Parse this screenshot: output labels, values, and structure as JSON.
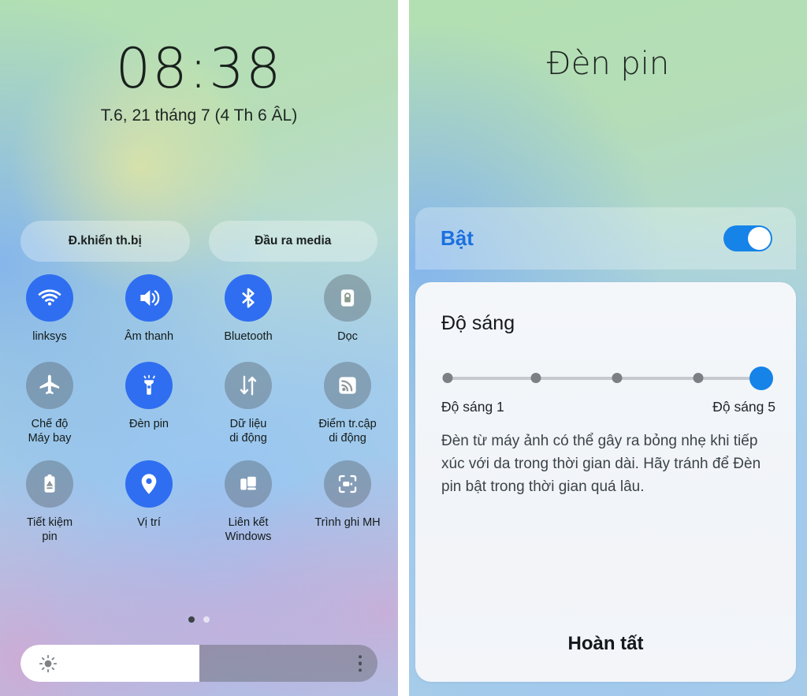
{
  "lockscreen": {
    "time": "08:38",
    "date": "T.6, 21 tháng 7 (4 Th 6 ÂL)"
  },
  "quick_panel": {
    "pills": [
      {
        "label": "Đ.khiển th.bị",
        "icon": "device-control-icon"
      },
      {
        "label": "Đầu ra media",
        "icon": "media-output-icon"
      }
    ],
    "tiles": [
      {
        "label": "linksys",
        "icon": "wifi-icon",
        "state": "on"
      },
      {
        "label": "Âm thanh",
        "icon": "sound-icon",
        "state": "on"
      },
      {
        "label": "Bluetooth",
        "icon": "bluetooth-icon",
        "state": "on"
      },
      {
        "label": "Dọc",
        "icon": "rotation-lock-icon",
        "state": "off"
      },
      {
        "label": "Chế độ\nMáy bay",
        "icon": "airplane-icon",
        "state": "off"
      },
      {
        "label": "Đèn pin",
        "icon": "flashlight-icon",
        "state": "on"
      },
      {
        "label": "Dữ liệu\ndi động",
        "icon": "mobile-data-icon",
        "state": "off"
      },
      {
        "label": "Điểm tr.cập\ndi động",
        "icon": "hotspot-icon",
        "state": "off"
      },
      {
        "label": "Tiết kiệm\npin",
        "icon": "power-saving-icon",
        "state": "off"
      },
      {
        "label": "Vị trí",
        "icon": "location-pin-icon",
        "state": "on"
      },
      {
        "label": "Liên kết\nWindows",
        "icon": "link-to-windows-icon",
        "state": "off"
      },
      {
        "label": "Trình ghi MH",
        "icon": "screen-recorder-icon",
        "state": "off"
      }
    ],
    "pages": {
      "count": 2,
      "active": 1
    },
    "brightness": {
      "percent": 50,
      "sun_icon": "brightness-sun-icon",
      "menu_icon": "more-options-icon"
    }
  },
  "flashlight_dialog": {
    "title": "Đèn pin",
    "toggle": {
      "label": "Bật",
      "state": "on"
    },
    "brightness": {
      "heading": "Độ sáng",
      "min_label": "Độ sáng 1",
      "max_label": "Độ sáng 5",
      "steps": 5,
      "value": 5
    },
    "note": "Đèn từ máy ảnh có thể gây ra bỏng nhẹ khi tiếp xúc với da trong thời gian dài. Hãy tránh để Đèn pin bật trong thời gian quá lâu.",
    "done_label": "Hoàn tất"
  },
  "colors": {
    "accent_blue": "#2f6ef0",
    "toggle_blue": "#1583e8",
    "on_text_blue": "#1b6fe0",
    "inactive_grey": "rgba(86,96,102,0.40)",
    "card_bg": "#f2f5f9"
  }
}
